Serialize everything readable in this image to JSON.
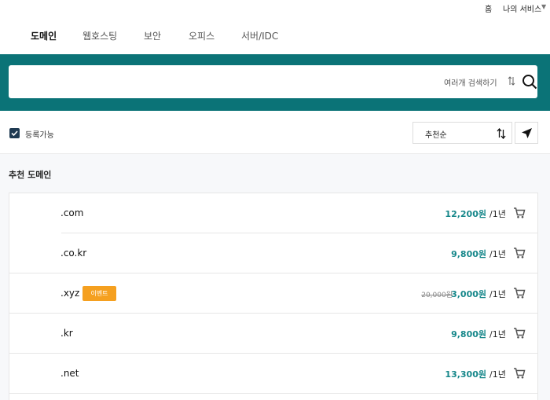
{
  "util": {
    "home": "홈",
    "my_services": "나의 서비스",
    "caret": "▼"
  },
  "nav": {
    "tabs": [
      {
        "label": "도메인",
        "active": true
      },
      {
        "label": "웹호스팅",
        "active": false
      },
      {
        "label": "보안",
        "active": false
      },
      {
        "label": "오피스",
        "active": false
      },
      {
        "label": "서버/IDC",
        "active": false
      }
    ]
  },
  "search": {
    "value": "",
    "multi_search_label": "여러개 검색하기"
  },
  "filter": {
    "available_label": "등록가능",
    "available_checked": true,
    "sort_value": "추천순"
  },
  "section": {
    "title": "추천 도메인"
  },
  "domains": [
    {
      "tld": ".com",
      "badge": "",
      "original_price": "",
      "price": "12,200원",
      "period": "/1년"
    },
    {
      "tld": ".co.kr",
      "badge": "",
      "original_price": "",
      "price": "9,800원",
      "period": "/1년"
    },
    {
      "tld": ".xyz",
      "badge": "이벤트",
      "original_price": "20,000원",
      "price": "3,000원",
      "period": "/1년"
    },
    {
      "tld": ".kr",
      "badge": "",
      "original_price": "",
      "price": "9,800원",
      "period": "/1년"
    },
    {
      "tld": ".net",
      "badge": "",
      "original_price": "",
      "price": "13,300원",
      "period": "/1년"
    }
  ],
  "colors": {
    "teal": "#0b7377",
    "price": "#16878a",
    "badge": "#f5a020",
    "checkbox": "#1f3a52"
  },
  "icons": {
    "search": "search-icon",
    "sort": "sort-icon",
    "send": "send-icon",
    "cart": "cart-icon",
    "check": "check-icon"
  }
}
